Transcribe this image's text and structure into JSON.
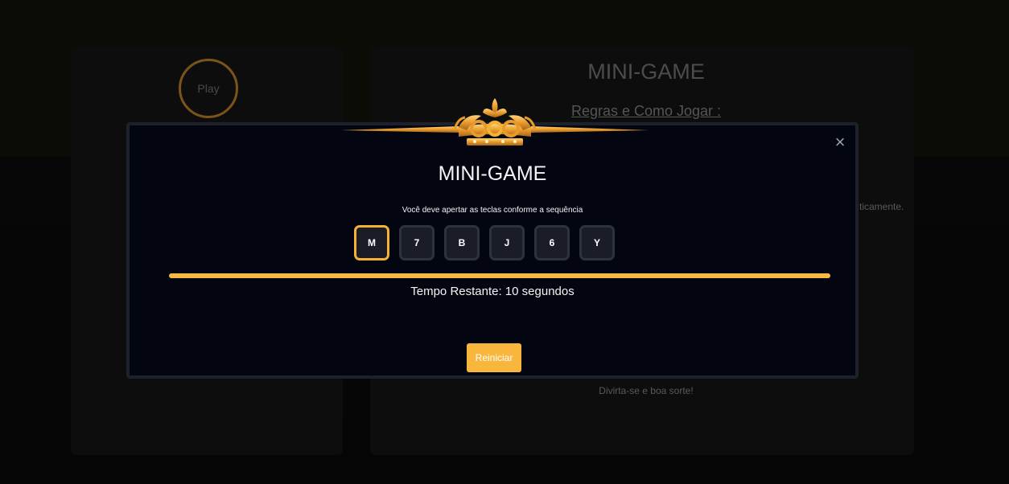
{
  "background": {
    "play_label": "Play",
    "title": "MINI-GAME",
    "rules_link": "Regras e Como Jogar :",
    "partial_text": "ticamente.",
    "footer": "Divirta-se e boa sorte!"
  },
  "modal": {
    "title": "MINI-GAME",
    "close_glyph": "×",
    "instruction": "Você deve apertar as teclas conforme a sequência",
    "keys": [
      "M",
      "7",
      "B",
      "J",
      "6",
      "Y"
    ],
    "active_key_index": 0,
    "progress_fraction": 1.0,
    "timer_prefix": "Tempo Restante: ",
    "timer_value": "10",
    "timer_suffix": " segundos",
    "restart_label": "Reiniciar"
  },
  "colors": {
    "accent_gold": "#f6ba42",
    "modal_bg": "#030610",
    "key_bg": "#1a1d27"
  },
  "icons": {
    "close": "close-icon",
    "crown": "crown-ornament-icon"
  }
}
